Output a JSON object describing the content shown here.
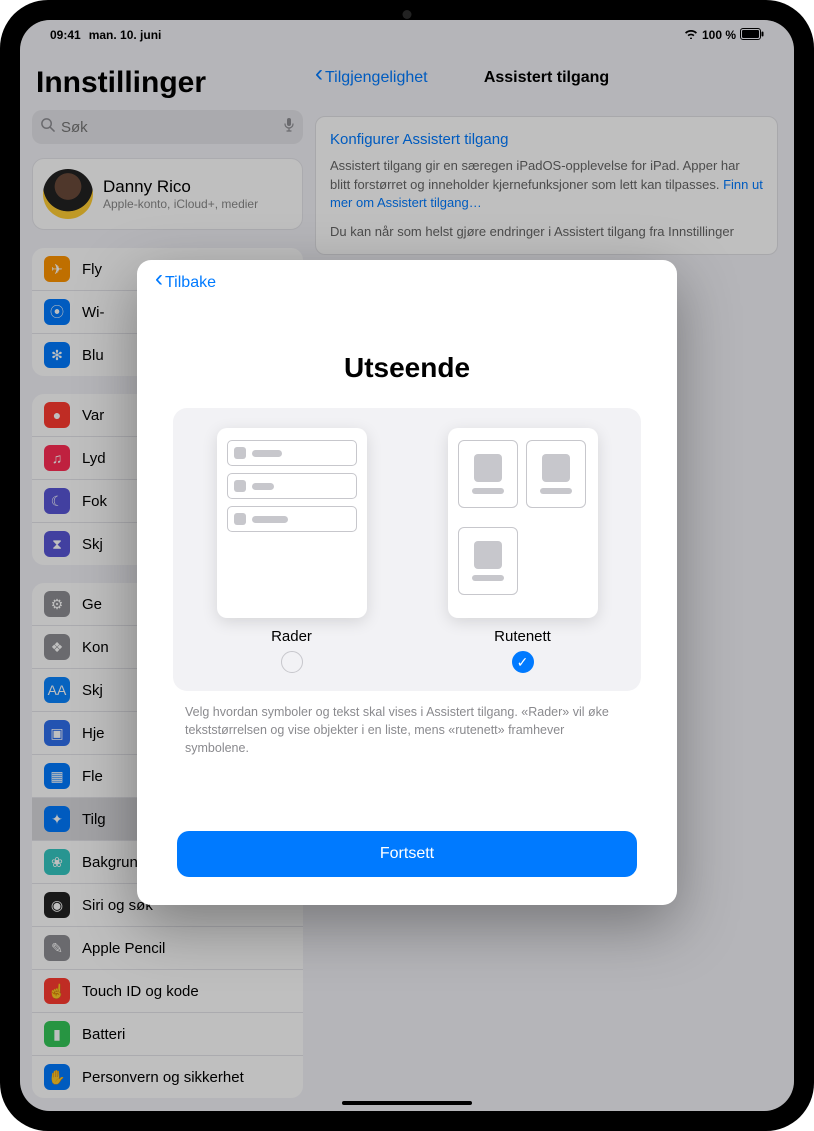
{
  "status": {
    "time": "09:41",
    "date": "man. 10. juni",
    "battery": "100 %"
  },
  "sidebar": {
    "title": "Innstillinger",
    "search_placeholder": "Søk",
    "profile": {
      "name": "Danny Rico",
      "sub": "Apple-konto, iCloud+, medier"
    },
    "group1": [
      {
        "label": "Fly",
        "color": "#ff9500",
        "glyph": "✈"
      },
      {
        "label": "Wi-",
        "color": "#007aff",
        "glyph": "⦿"
      },
      {
        "label": "Blu",
        "color": "#007aff",
        "glyph": "✻"
      }
    ],
    "group2": [
      {
        "label": "Var",
        "color": "#ff3b30",
        "glyph": "●"
      },
      {
        "label": "Lyd",
        "color": "#ff2d55",
        "glyph": "♫"
      },
      {
        "label": "Fok",
        "color": "#5856d6",
        "glyph": "☾"
      },
      {
        "label": "Skj",
        "color": "#5856d6",
        "glyph": "⧗"
      }
    ],
    "group3": [
      {
        "label": "Ge",
        "color": "#8e8e93",
        "glyph": "⚙"
      },
      {
        "label": "Kon",
        "color": "#8e8e93",
        "glyph": "❖"
      },
      {
        "label": "Skj",
        "color": "#0a84ff",
        "glyph": "AA"
      },
      {
        "label": "Hje",
        "color": "#2f6fed",
        "glyph": "▣"
      },
      {
        "label": "Fle",
        "color": "#007aff",
        "glyph": "▦"
      },
      {
        "label": "Tilg",
        "color": "#007aff",
        "glyph": "✦",
        "selected": true
      },
      {
        "label": "Bakgrunn",
        "color": "#34c7c2",
        "glyph": "❀"
      },
      {
        "label": "Siri og søk",
        "color": "#222",
        "glyph": "◉"
      },
      {
        "label": "Apple Pencil",
        "color": "#8e8e93",
        "glyph": "✎"
      },
      {
        "label": "Touch ID og kode",
        "color": "#ff3b30",
        "glyph": "☝"
      },
      {
        "label": "Batteri",
        "color": "#34c759",
        "glyph": "▮"
      },
      {
        "label": "Personvern og sikkerhet",
        "color": "#007aff",
        "glyph": "✋"
      }
    ]
  },
  "detail": {
    "back": "Tilgjengelighet",
    "title": "Assistert tilgang",
    "configure": "Konfigurer Assistert tilgang",
    "desc": "Assistert tilgang gir en særegen iPadOS-opplevelse for iPad. Apper har blitt forstørret og inneholder kjernefunksjoner som lett kan tilpasses.",
    "learn": "Finn ut mer om Assistert tilgang…",
    "footer": "Du kan når som helst gjøre endringer i Assistert tilgang fra Innstillinger"
  },
  "modal": {
    "back": "Tilbake",
    "title": "Utseende",
    "option_rows": "Rader",
    "option_grid": "Rutenett",
    "help": "Velg hvordan symboler og tekst skal vises i Assistert tilgang. «Rader» vil øke tekststørrelsen og vise objekter i en liste, mens «rutenett» framhever symbolene.",
    "continue": "Fortsett",
    "selected": "grid"
  }
}
